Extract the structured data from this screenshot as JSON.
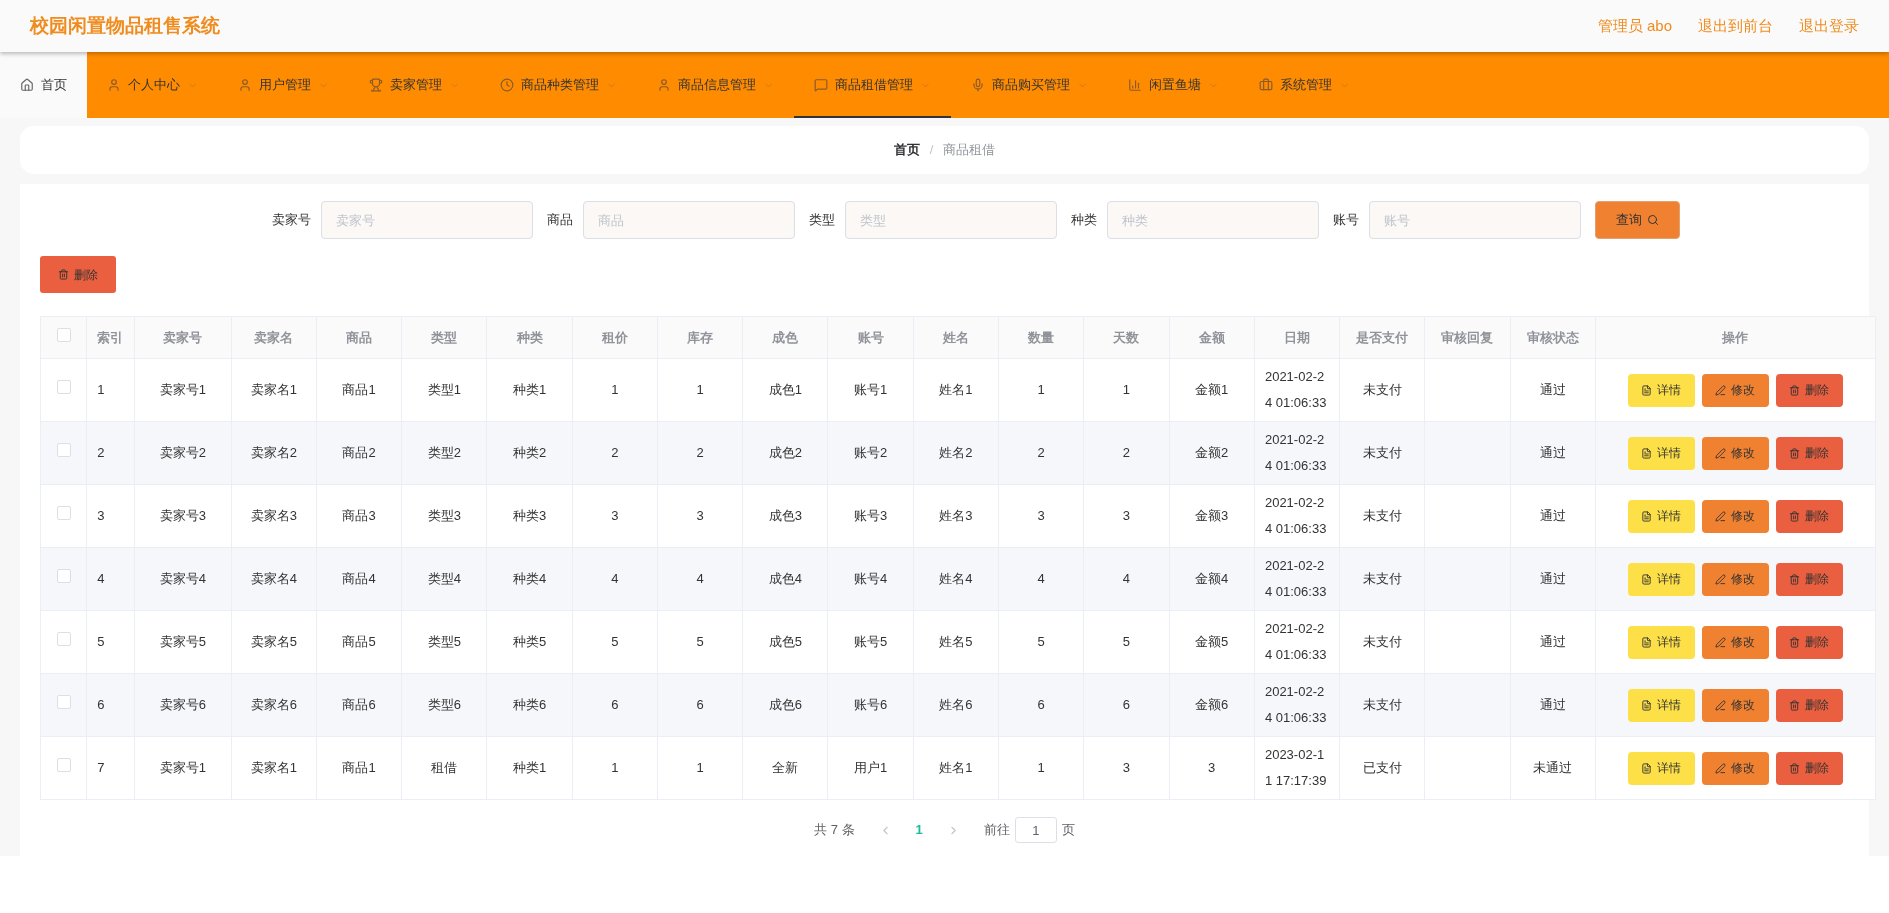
{
  "header": {
    "title": "校园闲置物品租售系统",
    "links": [
      "管理员 abo",
      "退出到前台",
      "退出登录"
    ]
  },
  "nav": [
    {
      "label": "首页",
      "selected": true,
      "underlined": false,
      "dropdown": false
    },
    {
      "label": "个人中心",
      "selected": false,
      "underlined": false,
      "dropdown": true
    },
    {
      "label": "用户管理",
      "selected": false,
      "underlined": false,
      "dropdown": true
    },
    {
      "label": "卖家管理",
      "selected": false,
      "underlined": false,
      "dropdown": true
    },
    {
      "label": "商品种类管理",
      "selected": false,
      "underlined": false,
      "dropdown": true
    },
    {
      "label": "商品信息管理",
      "selected": false,
      "underlined": false,
      "dropdown": true
    },
    {
      "label": "商品租借管理",
      "selected": false,
      "underlined": true,
      "dropdown": true
    },
    {
      "label": "商品购买管理",
      "selected": false,
      "underlined": false,
      "dropdown": true
    },
    {
      "label": "闲置鱼塘",
      "selected": false,
      "underlined": false,
      "dropdown": true
    },
    {
      "label": "系统管理",
      "selected": false,
      "underlined": false,
      "dropdown": true
    }
  ],
  "breadcrumb": {
    "items": [
      "首页",
      "商品租借"
    ],
    "separator": "/"
  },
  "search": {
    "fields": [
      {
        "label": "卖家号",
        "placeholder": "卖家号"
      },
      {
        "label": "商品",
        "placeholder": "商品"
      },
      {
        "label": "类型",
        "placeholder": "类型"
      },
      {
        "label": "种类",
        "placeholder": "种类"
      },
      {
        "label": "账号",
        "placeholder": "账号"
      }
    ],
    "button": "查询"
  },
  "delete_button": "删除",
  "table": {
    "columns": [
      "索引",
      "卖家号",
      "卖家名",
      "商品",
      "类型",
      "种类",
      "租价",
      "库存",
      "成色",
      "账号",
      "姓名",
      "数量",
      "天数",
      "金额",
      "日期",
      "是否支付",
      "审核回复",
      "审核状态",
      "操作"
    ],
    "all_checked": false,
    "rows": [
      {
        "checked": false,
        "actions": [
          "详情",
          "修改",
          "删除"
        ],
        "cells": [
          "1",
          "卖家号1",
          "卖家名1",
          "商品1",
          "类型1",
          "种类1",
          "1",
          "1",
          "成色1",
          "账号1",
          "姓名1",
          "1",
          "1",
          "金额1",
          "2021-02-24 01:06:33",
          "未支付",
          "",
          "通过"
        ]
      },
      {
        "checked": false,
        "actions": [
          "详情",
          "修改",
          "删除"
        ],
        "cells": [
          "2",
          "卖家号2",
          "卖家名2",
          "商品2",
          "类型2",
          "种类2",
          "2",
          "2",
          "成色2",
          "账号2",
          "姓名2",
          "2",
          "2",
          "金额2",
          "2021-02-24 01:06:33",
          "未支付",
          "",
          "通过"
        ]
      },
      {
        "checked": false,
        "actions": [
          "详情",
          "修改",
          "删除"
        ],
        "cells": [
          "3",
          "卖家号3",
          "卖家名3",
          "商品3",
          "类型3",
          "种类3",
          "3",
          "3",
          "成色3",
          "账号3",
          "姓名3",
          "3",
          "3",
          "金额3",
          "2021-02-24 01:06:33",
          "未支付",
          "",
          "通过"
        ]
      },
      {
        "checked": false,
        "actions": [
          "详情",
          "修改",
          "删除"
        ],
        "cells": [
          "4",
          "卖家号4",
          "卖家名4",
          "商品4",
          "类型4",
          "种类4",
          "4",
          "4",
          "成色4",
          "账号4",
          "姓名4",
          "4",
          "4",
          "金额4",
          "2021-02-24 01:06:33",
          "未支付",
          "",
          "通过"
        ]
      },
      {
        "checked": false,
        "actions": [
          "详情",
          "修改",
          "删除"
        ],
        "cells": [
          "5",
          "卖家号5",
          "卖家名5",
          "商品5",
          "类型5",
          "种类5",
          "5",
          "5",
          "成色5",
          "账号5",
          "姓名5",
          "5",
          "5",
          "金额5",
          "2021-02-24 01:06:33",
          "未支付",
          "",
          "通过"
        ]
      },
      {
        "checked": false,
        "actions": [
          "详情",
          "修改",
          "删除"
        ],
        "cells": [
          "6",
          "卖家号6",
          "卖家名6",
          "商品6",
          "类型6",
          "种类6",
          "6",
          "6",
          "成色6",
          "账号6",
          "姓名6",
          "6",
          "6",
          "金额6",
          "2021-02-24 01:06:33",
          "未支付",
          "",
          "通过"
        ]
      },
      {
        "checked": false,
        "actions": [
          "详情",
          "修改",
          "删除"
        ],
        "cells": [
          "7",
          "卖家号1",
          "卖家名1",
          "商品1",
          "租借",
          "种类1",
          "1",
          "1",
          "全新",
          "用户1",
          "姓名1",
          "1",
          "3",
          "3",
          "2023-02-11 17:17:39",
          "已支付",
          "",
          "未通过"
        ]
      }
    ]
  },
  "pagination": {
    "total": "共 7 条",
    "pages": [
      {
        "label": "1",
        "selected": true
      }
    ],
    "goto_label": "前往",
    "goto_value": "1",
    "page_unit": "页"
  }
}
